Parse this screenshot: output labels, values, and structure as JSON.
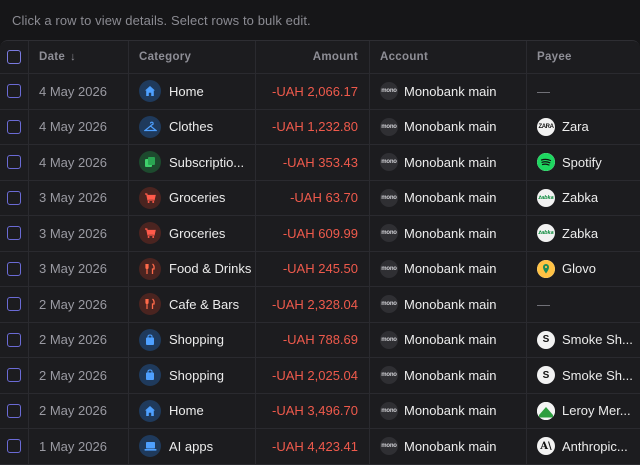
{
  "hint": "Click a row to view details. Select rows to bulk edit.",
  "columns": {
    "date": "Date",
    "category": "Category",
    "amount": "Amount",
    "account": "Account",
    "payee": "Payee"
  },
  "colors": {
    "negative": "#ef5a4c",
    "checkbox": "#6b6bd6"
  },
  "rows": [
    {
      "date": "4 May 2026",
      "category": "Home",
      "cat_icon": "home-icon",
      "cat_bg": "#1f3a5c",
      "amount": "-UAH 2,066.17",
      "account": "Monobank main",
      "account_badge": "mono",
      "payee": "—",
      "payee_icon": ""
    },
    {
      "date": "4 May 2026",
      "category": "Clothes",
      "cat_icon": "hanger-icon",
      "cat_bg": "#1f3a5c",
      "amount": "-UAH 1,232.80",
      "account": "Monobank main",
      "account_badge": "mono",
      "payee": "Zara",
      "payee_icon": "zara-logo-icon"
    },
    {
      "date": "4 May 2026",
      "category": "Subscriptio...",
      "cat_icon": "subscriptions-icon",
      "cat_bg": "#1d4a2e",
      "amount": "-UAH 353.43",
      "account": "Monobank main",
      "account_badge": "mono",
      "payee": "Spotify",
      "payee_icon": "spotify-logo-icon"
    },
    {
      "date": "3 May 2026",
      "category": "Groceries",
      "cat_icon": "cart-icon",
      "cat_bg": "#4a2420",
      "amount": "-UAH 63.70",
      "account": "Monobank main",
      "account_badge": "mono",
      "payee": "Zabka",
      "payee_icon": "zabka-logo-icon"
    },
    {
      "date": "3 May 2026",
      "category": "Groceries",
      "cat_icon": "cart-icon",
      "cat_bg": "#4a2420",
      "amount": "-UAH 609.99",
      "account": "Monobank main",
      "account_badge": "mono",
      "payee": "Zabka",
      "payee_icon": "zabka-logo-icon"
    },
    {
      "date": "3 May 2026",
      "category": "Food & Drinks",
      "cat_icon": "fork-knife-icon",
      "cat_bg": "#4a2420",
      "amount": "-UAH 245.50",
      "account": "Monobank main",
      "account_badge": "mono",
      "payee": "Glovo",
      "payee_icon": "glovo-logo-icon"
    },
    {
      "date": "2 May 2026",
      "category": "Cafe & Bars",
      "cat_icon": "fork-knife-icon",
      "cat_bg": "#4a2420",
      "amount": "-UAH 2,328.04",
      "account": "Monobank main",
      "account_badge": "mono",
      "payee": "—",
      "payee_icon": ""
    },
    {
      "date": "2 May 2026",
      "category": "Shopping",
      "cat_icon": "shopping-bag-icon",
      "cat_bg": "#1f3a5c",
      "amount": "-UAH 788.69",
      "account": "Monobank main",
      "account_badge": "mono",
      "payee": "Smoke Sh...",
      "payee_icon": "smoke-shop-logo-icon"
    },
    {
      "date": "2 May 2026",
      "category": "Shopping",
      "cat_icon": "shopping-bag-icon",
      "cat_bg": "#1f3a5c",
      "amount": "-UAH 2,025.04",
      "account": "Monobank main",
      "account_badge": "mono",
      "payee": "Smoke Sh...",
      "payee_icon": "smoke-shop-logo-icon"
    },
    {
      "date": "2 May 2026",
      "category": "Home",
      "cat_icon": "home-icon",
      "cat_bg": "#1f3a5c",
      "amount": "-UAH 3,496.70",
      "account": "Monobank main",
      "account_badge": "mono",
      "payee": "Leroy Mer...",
      "payee_icon": "leroy-merlin-logo-icon"
    },
    {
      "date": "1 May 2026",
      "category": "AI apps",
      "cat_icon": "laptop-icon",
      "cat_bg": "#1f3a5c",
      "amount": "-UAH 4,423.41",
      "account": "Monobank main",
      "account_badge": "mono",
      "payee": "Anthropic...",
      "payee_icon": "anthropic-logo-icon"
    }
  ]
}
